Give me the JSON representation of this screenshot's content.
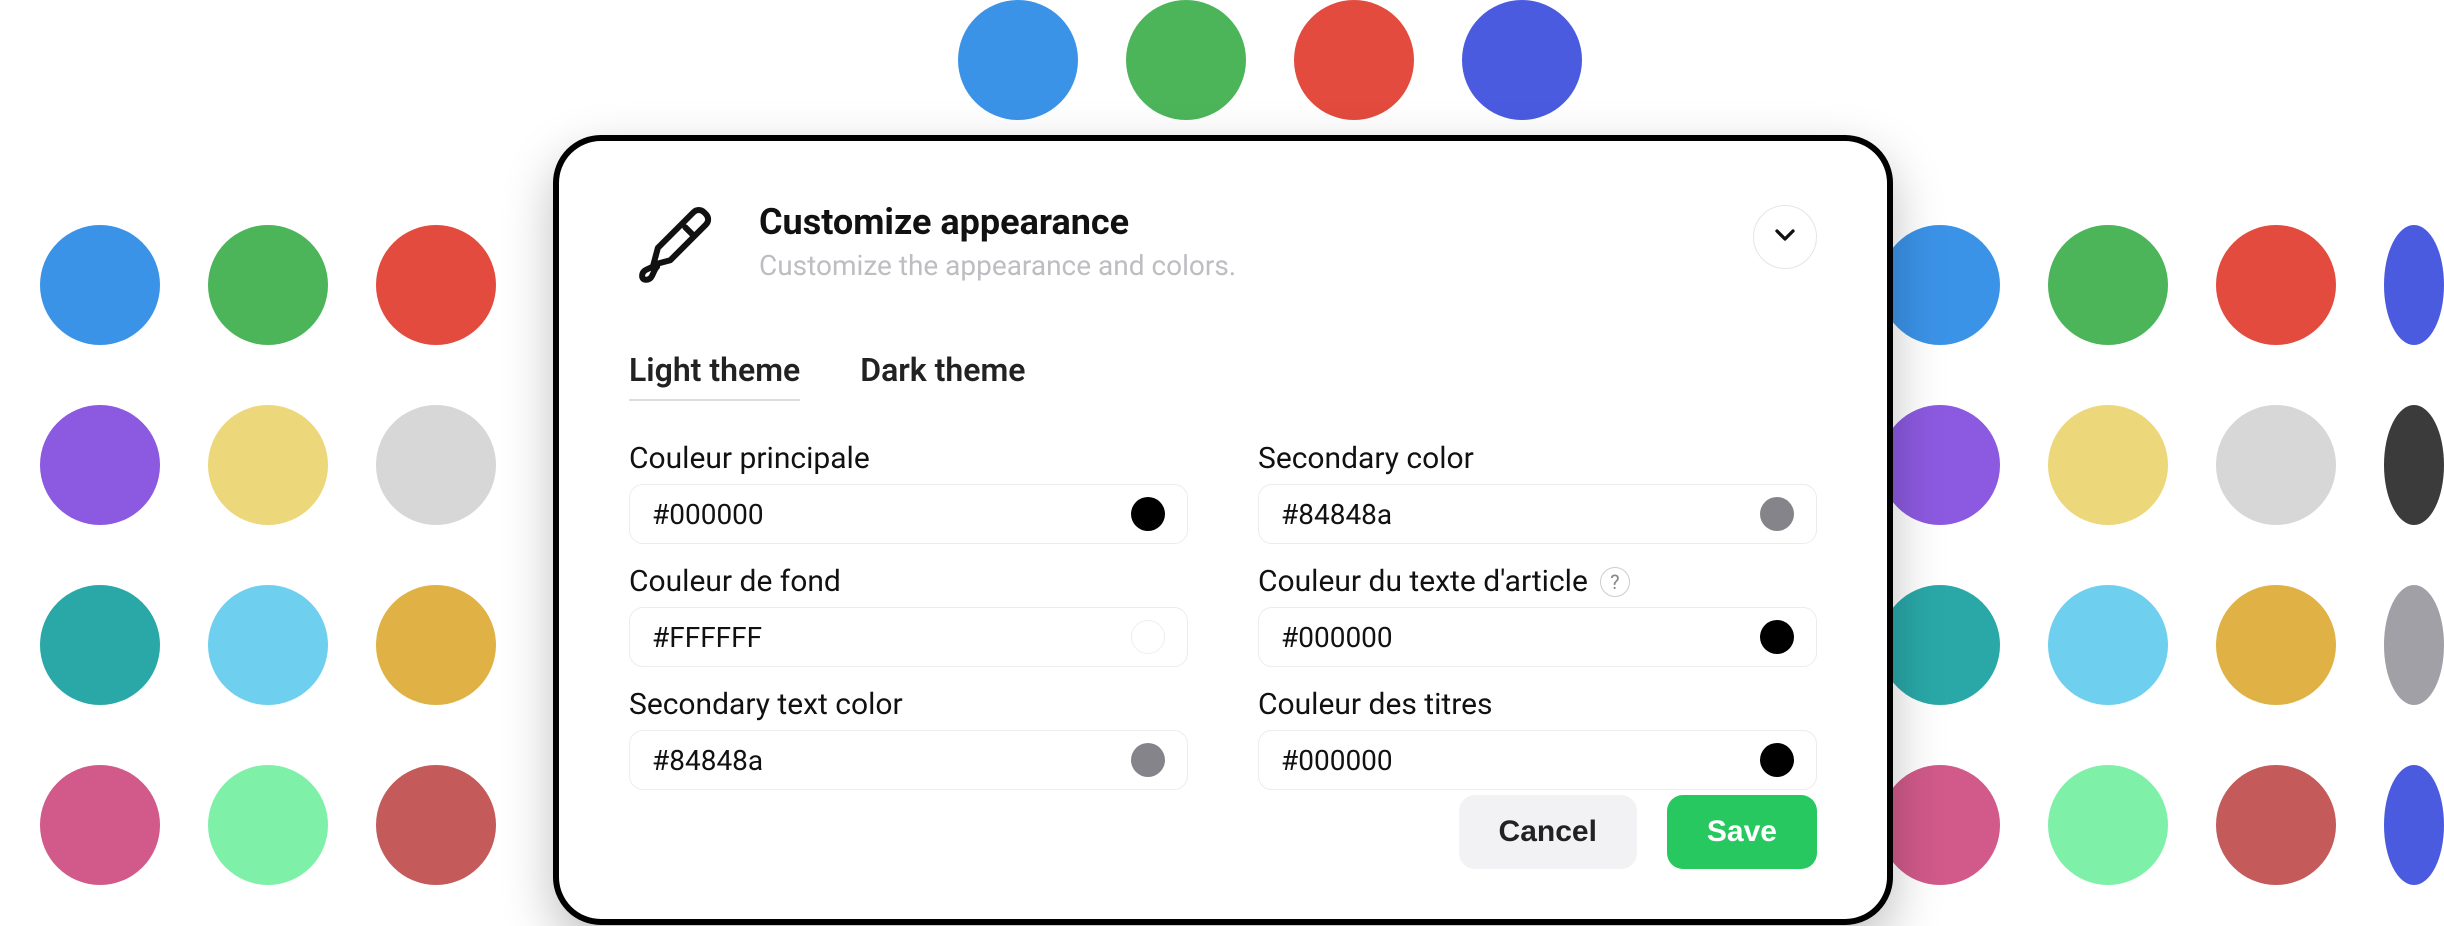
{
  "header": {
    "title": "Customize appearance",
    "subtitle": "Customize the appearance and colors."
  },
  "tabs": {
    "light": "Light theme",
    "dark": "Dark theme"
  },
  "fields": {
    "primary": {
      "label": "Couleur principale",
      "value": "#000000",
      "color": "#000000"
    },
    "secondary": {
      "label": "Secondary color",
      "value": "#84848a",
      "color": "#84848a"
    },
    "background": {
      "label": "Couleur de fond",
      "value": "#FFFFFF",
      "color": "#FFFFFF"
    },
    "articleText": {
      "label": "Couleur du texte d'article",
      "value": "#000000",
      "color": "#000000",
      "help": "?"
    },
    "secondaryText": {
      "label": "Secondary text color",
      "value": "#84848a",
      "color": "#84848a"
    },
    "titles": {
      "label": "Couleur des titres",
      "value": "#000000",
      "color": "#000000"
    }
  },
  "buttons": {
    "cancel": "Cancel",
    "save": "Save"
  },
  "bgDots": {
    "topRow": [
      "#3b93e8",
      "#4cb55a",
      "#e24b3e",
      "#4a5be0"
    ],
    "row1": [
      "#3b93e8",
      "#4cb55a",
      "#e24b3e",
      "#3b93e8",
      "#4cb55a",
      "#e24b3e",
      "#4a5be0"
    ],
    "row2": [
      "#8c5ae0",
      "#ecd87a",
      "#d7d7d7",
      "#8c5ae0",
      "#ecd87a",
      "#d7d7d7",
      "#3b3b3b"
    ],
    "row3": [
      "#2aa8a8",
      "#6ed0ee",
      "#e0b245",
      "#2aa8a8",
      "#6ed0ee",
      "#e0b245",
      "#a0a0a6"
    ],
    "row4": [
      "#d15a8a",
      "#7ff0a8",
      "#c55a5a",
      "#d15a8a",
      "#7ff0a8",
      "#c55a5a",
      "#4a5be0"
    ]
  }
}
